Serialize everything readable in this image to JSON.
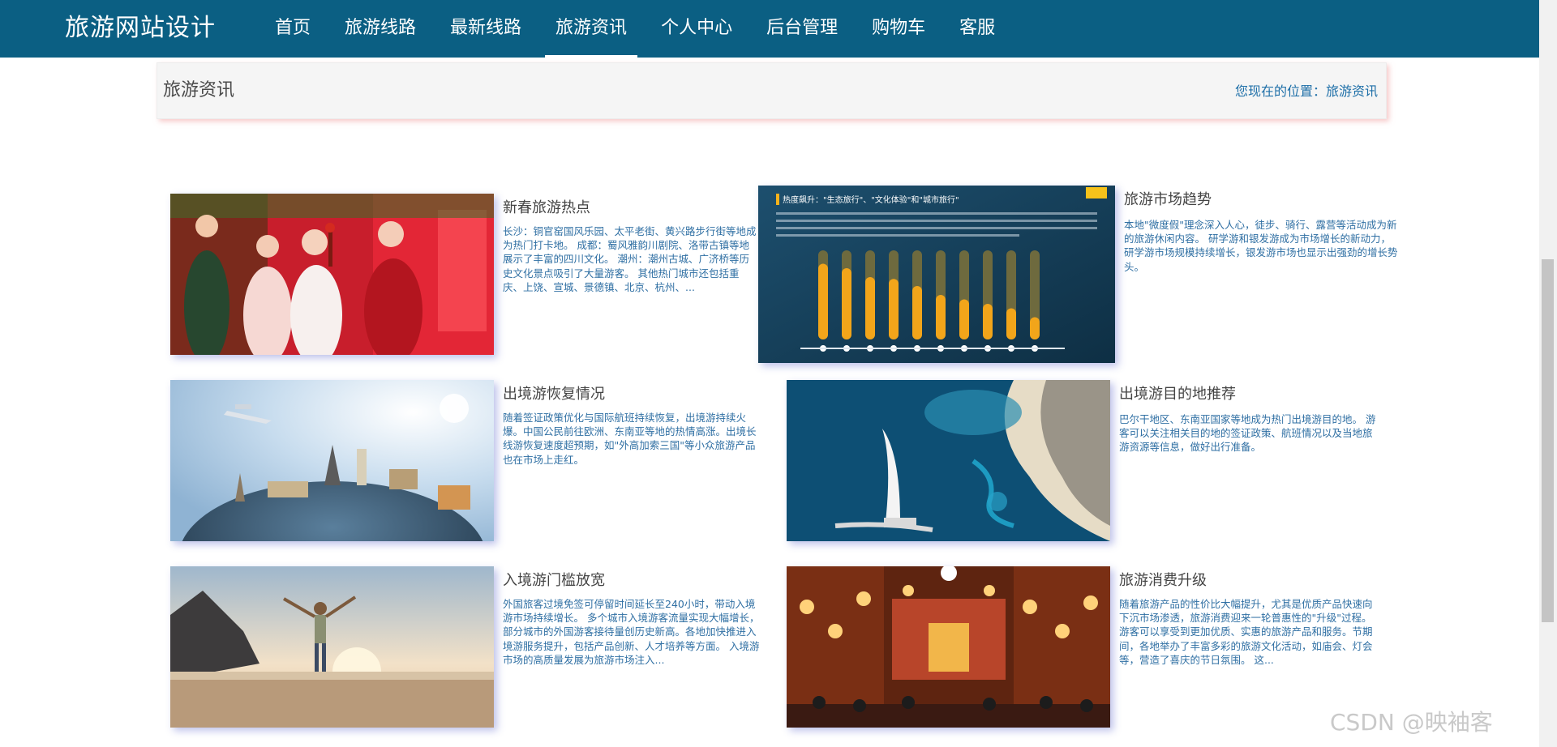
{
  "app": {
    "brand": "旅游网站设计"
  },
  "nav": {
    "items": [
      {
        "label": "首页"
      },
      {
        "label": "旅游线路"
      },
      {
        "label": "最新线路"
      },
      {
        "label": "旅游资讯",
        "active": true
      },
      {
        "label": "个人中心"
      },
      {
        "label": "后台管理"
      },
      {
        "label": "购物车"
      },
      {
        "label": "客服"
      }
    ]
  },
  "breadcrumb": {
    "title": "旅游资讯",
    "location_prefix": "您现在的位置：",
    "location_current": "旅游资讯"
  },
  "news": [
    {
      "title": "新春旅游热点",
      "image": "spring-festival-hanfu-photo",
      "desc": "长沙：铜官窑国风乐园、太平老街、黄兴路步行街等地成为热门打卡地。 成都：蜀风雅韵川剧院、洛带古镇等地展示了丰富的四川文化。 潮州：潮州古城、广济桥等历史文化景点吸引了大量游客。 其他热门城市还包括重庆、上饶、宣城、景德镇、北京、杭州、..."
    },
    {
      "title": "旅游市场趋势",
      "image": "travel-trend-infographic",
      "image_heading": "热度飙升：\"生态旅行\"、\"文化体验\"和\"城市旅行\"",
      "desc": "本地\"微度假\"理念深入人心，徒步、骑行、露营等活动成为新的旅游休闲内容。 研学游和银发游成为市场增长的新动力，研学游市场规模持续增长，银发游市场也显示出强劲的增长势头。"
    },
    {
      "title": "出境游恢复情况",
      "image": "world-landmarks-globe-photo",
      "desc": "随着签证政策优化与国际航班持续恢复，出境游持续火爆。中国公民前往欧洲、东南亚等地的热情高涨。出境长线游恢复速度超预期，如\"外高加索三国\"等小众旅游产品也在市场上走红。"
    },
    {
      "title": "出境游目的地推荐",
      "image": "dubai-coastline-aerial-photo",
      "desc": "巴尔干地区、东南亚国家等地成为热门出境游目的地。 游客可以关注相关目的地的签证政策、航班情况以及当地旅游资源等信息，做好出行准备。"
    },
    {
      "title": "入境游门槛放宽",
      "image": "traveler-on-beach-photo",
      "desc": "外国旅客过境免签可停留时间延长至240小时，带动入境游市场持续增长。 多个城市入境游客流量实现大幅增长，部分城市的外国游客接待量创历史新高。各地加快推进入境游服务提升，包括产品创新、人才培养等方面。 入境游市场的高质量发展为旅游市场注入..."
    },
    {
      "title": "旅游消费升级",
      "image": "lantern-night-market-photo",
      "desc": "随着旅游产品的性价比大幅提升，尤其是优质产品快速向下沉市场渗透，旅游消费迎来一轮普惠性的\"升级\"过程。 游客可以享受到更加优质、实惠的旅游产品和服务。节期间，各地举办了丰富多彩的旅游文化活动，如庙会、灯会等，营造了喜庆的节日氛围。 这..."
    }
  ],
  "watermark": "CSDN @映袖客",
  "colors": {
    "nav_bg": "#0b5f83",
    "link_blue": "#2f6fa3",
    "title_gray": "#444444",
    "crumb_bg": "#f5f5f5"
  }
}
